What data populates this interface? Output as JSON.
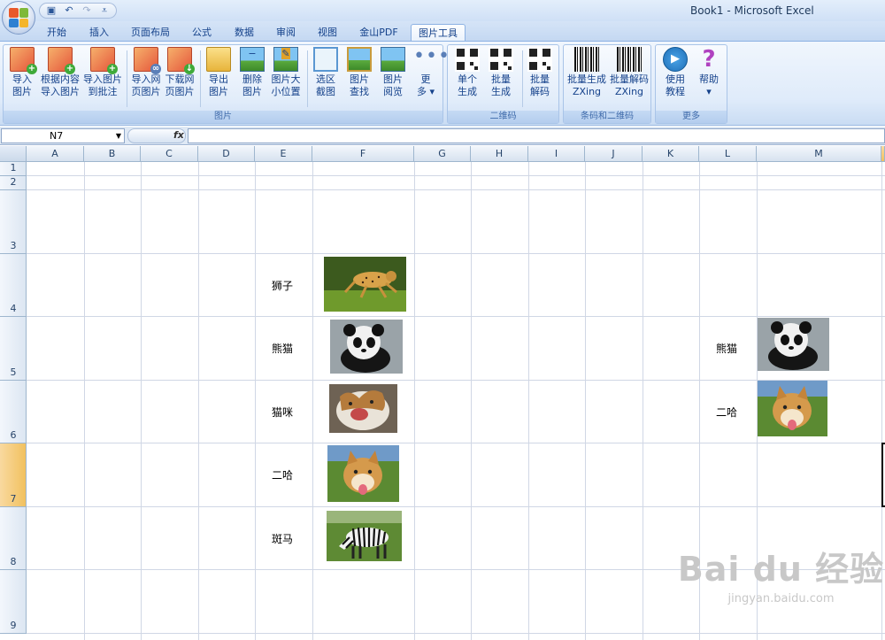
{
  "window": {
    "title": "Book1 - Microsoft Excel"
  },
  "qat": {
    "save_icon": "save-icon",
    "undo_icon": "undo-icon",
    "redo_icon": "redo-icon",
    "customize_icon": "customize-icon"
  },
  "tabs": [
    {
      "label": "开始"
    },
    {
      "label": "插入"
    },
    {
      "label": "页面布局"
    },
    {
      "label": "公式"
    },
    {
      "label": "数据"
    },
    {
      "label": "审阅"
    },
    {
      "label": "视图"
    },
    {
      "label": "金山PDF"
    },
    {
      "label": "图片工具",
      "active": true
    }
  ],
  "ribbon": {
    "groups": [
      {
        "label": "图片",
        "buttons": [
          {
            "line1": "导入",
            "line2": "图片",
            "icon": "import-picture-icon"
          },
          {
            "line1": "根据内容",
            "line2": "导入图片",
            "icon": "import-by-content-icon"
          },
          {
            "line1": "导入图片",
            "line2": "到批注",
            "icon": "import-to-comment-icon"
          },
          {
            "line1": "导入网",
            "line2": "页图片",
            "icon": "import-web-picture-icon"
          },
          {
            "line1": "下载网",
            "line2": "页图片",
            "icon": "download-web-picture-icon"
          },
          {
            "line1": "导出",
            "line2": "图片",
            "icon": "export-picture-icon"
          },
          {
            "line1": "删除",
            "line2": "图片",
            "icon": "delete-picture-icon"
          },
          {
            "line1": "图片大",
            "line2": "小位置",
            "icon": "picture-size-icon"
          },
          {
            "line1": "选区",
            "line2": "截图",
            "icon": "screenshot-icon"
          },
          {
            "line1": "图片",
            "line2": "查找",
            "icon": "find-picture-icon"
          },
          {
            "line1": "图片",
            "line2": "阅览",
            "icon": "browse-picture-icon"
          },
          {
            "line1": "更",
            "line2": "多 ▾",
            "icon": "more-icon"
          }
        ]
      },
      {
        "label": "二维码",
        "buttons": [
          {
            "line1": "单个",
            "line2": "生成",
            "icon": "qr-single-icon"
          },
          {
            "line1": "批量",
            "line2": "生成",
            "icon": "qr-batch-icon"
          },
          {
            "line1": "批量",
            "line2": "解码",
            "icon": "qr-decode-icon"
          }
        ]
      },
      {
        "label": "条码和二维码",
        "buttons": [
          {
            "line1": "批量生成",
            "line2": "ZXing",
            "icon": "barcode-generate-icon"
          },
          {
            "line1": "批量解码",
            "line2": "ZXing",
            "icon": "barcode-decode-icon"
          }
        ]
      },
      {
        "label": "更多",
        "buttons": [
          {
            "line1": "使用",
            "line2": "教程",
            "icon": "tutorial-icon"
          },
          {
            "line1": "帮助",
            "line2": "▾",
            "icon": "help-icon"
          }
        ]
      }
    ]
  },
  "formula_bar": {
    "name_box": "N7",
    "fx": "fx",
    "formula": ""
  },
  "columns": [
    "A",
    "B",
    "C",
    "D",
    "E",
    "F",
    "G",
    "H",
    "I",
    "J",
    "K",
    "L",
    "M"
  ],
  "rows": [
    "1",
    "2",
    "3",
    "4",
    "5",
    "6",
    "7",
    "8",
    "9"
  ],
  "selected": {
    "column": "N",
    "row": "7"
  },
  "cells": {
    "E4": "狮子",
    "E5": "熊猫",
    "E6": "猫咪",
    "E7": "二哈",
    "E8": "斑马",
    "L5": "熊猫",
    "L6": "二哈"
  },
  "images": [
    {
      "cell": "F4",
      "subject": "cheetah-photo"
    },
    {
      "cell": "F5",
      "subject": "panda-photo"
    },
    {
      "cell": "F6",
      "subject": "cat-photo"
    },
    {
      "cell": "F7",
      "subject": "shiba-dog-photo"
    },
    {
      "cell": "F8",
      "subject": "zebra-photo"
    },
    {
      "cell": "M5",
      "subject": "panda-photo"
    },
    {
      "cell": "M6",
      "subject": "shiba-dog-photo"
    }
  ],
  "watermark": {
    "brand": "Bai du 经验",
    "url": "jingyan.baidu.com"
  }
}
